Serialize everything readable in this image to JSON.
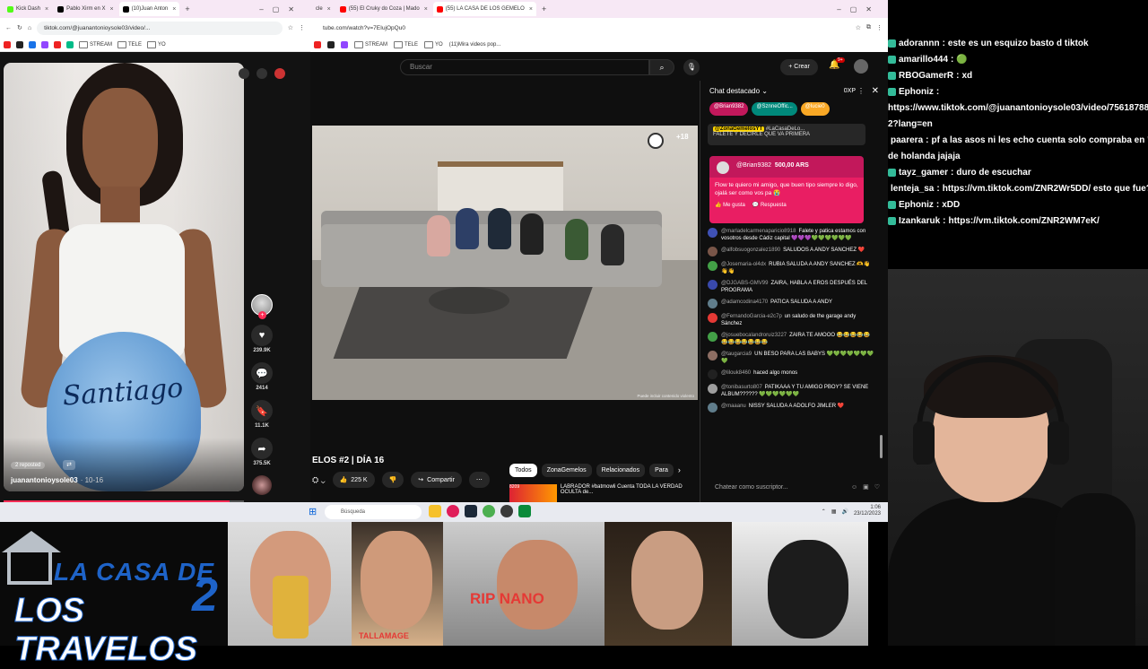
{
  "left_browser": {
    "tabs": [
      {
        "label": "Kick Dash",
        "color": "#53fc18",
        "active": false
      },
      {
        "label": "Pablo Xirm en X",
        "color": "#000000",
        "active": false
      },
      {
        "label": "(10)Juan Anton",
        "color": "#000000",
        "active": true
      }
    ],
    "url": "tiktok.com/@juanantonioysole03/video/...",
    "bookmarks": [
      "STREAM",
      "TELE",
      "YO"
    ]
  },
  "tiktok": {
    "belly_text": "Santiago",
    "reposted": "2 reposted",
    "username": "juanantonioysole03",
    "date": "· 10-16",
    "likes": "239.9K",
    "comments": "2414",
    "saves": "11.1K",
    "shares": "375.5K",
    "progress": 0.94
  },
  "mid_browser": {
    "tabs": [
      {
        "label": "cle",
        "color": "#ff0000",
        "active": false
      },
      {
        "label": "(55) El Cruky do Coza | Mado",
        "color": "#ff0000",
        "active": false
      },
      {
        "label": "(55) LA CASA DE LOS GEMELO",
        "color": "#ff0000",
        "active": true
      }
    ],
    "url": "tube.com/watch?v=7EIujOpQu0",
    "bookmarks": [
      "STREAM",
      "TELE",
      "YO",
      "(11)Mira videos pop..."
    ]
  },
  "youtube": {
    "search_placeholder": "Buscar",
    "create_label": "Crear",
    "notif_count": "9+",
    "age_badge": "+18",
    "disclaimer": "Puede incluir contenido violento",
    "title": "ELOS #2 | DÍA 16",
    "likes": "225 K",
    "share_label": "Compartir",
    "chips": [
      "Todos",
      "ZonaGemelos",
      "Relacionados",
      "Para"
    ],
    "rec_title": "LABRADOR #batmowli Cuenta TODA LA VERDAD OCULTA de...",
    "rec_badge": "8209"
  },
  "chat": {
    "header": "Chat destacado",
    "xp": "0XP",
    "tickers": [
      {
        "label": "@Brian9382",
        "color": "#c2185b"
      },
      {
        "label": "@SznneOffic...",
        "color": "#00897b"
      },
      {
        "label": "@lucie0",
        "color": "#f9a825"
      }
    ],
    "pinned_author": "@ZonaGemelosYT",
    "pinned_tag": "#LaCasaDeLo...",
    "pinned_text": "FALETE Y DECIRLE QUE VA PRIMERA",
    "superchat": {
      "author": "@Brian9382",
      "amount": "500,00 ARS",
      "text": "Flow te quiero mi amigo, que buen tipo siempre lo digo, ojalá ser como vos pa 😭",
      "like": "Me gusta",
      "reply": "Respuesta"
    },
    "messages": [
      {
        "author": "@marladelcarmenaparicio8918",
        "text": "Falete y patica estamos con vosotros desde Cádiz capital 💜💜💜💚💚💚💚💚💚",
        "color": "#3f51b5"
      },
      {
        "author": "@alfobsuogonzalez1890",
        "text": "SALUDOS A ANDY SANCHEZ ❤️",
        "color": "#795548"
      },
      {
        "author": "@Josemaria-ol4dx",
        "text": "RUBIA SALUDA A ANDY SANCHEZ 🫶👋👋👋",
        "color": "#43a047"
      },
      {
        "author": "@DJGABS-GMV99",
        "text": "ZAIRA, HABLA A EROS DESPUÉS DEL PROGRAMA",
        "color": "#3949ab"
      },
      {
        "author": "@adamcodina4170",
        "text": "PATICA SALUDA A ANDY",
        "color": "#607d8b"
      },
      {
        "author": "@FernandoGarcia-e2c7p",
        "text": "un saludo de the garage andy Sánchez",
        "color": "#e53935"
      },
      {
        "author": "@josuebocalandroruiz3227",
        "text": "ZAIRA TE AMOOO 😂😂😂😂😂😂😂😂😂😂😂😂",
        "color": "#43a047"
      },
      {
        "author": "@taugarcia9",
        "text": "UN BESO PARA LAS BABYS 💚💚💚💚💚💚💚💚",
        "color": "#8d6e63"
      },
      {
        "author": "@lilouk8460",
        "text": "haced algo monos",
        "color": "#212121"
      },
      {
        "author": "@tonibasurto807",
        "text": "PATIKAAA Y TU AMIGO PBOY? SE VIENE ALBUM?????? 💚💚💚💚💚💚",
        "color": "#9e9e9e"
      },
      {
        "author": "@maaanu",
        "text": "NISSY SALUDA A ADOLFO JIMLER ❤️",
        "color": "#607d8b"
      }
    ],
    "input_placeholder": "Chatear como suscriptor..."
  },
  "taskbar": {
    "search": "Búsqueda",
    "time": "1:06",
    "date": "23/12/2023"
  },
  "twitch_chat": [
    {
      "user": "adorannn",
      "text": "este es un esquizo basto d tiktok"
    },
    {
      "user": "amarillo444",
      "text": "🟢"
    },
    {
      "user": "RBOGamerR",
      "text": "xd"
    },
    {
      "user": "Ephoniz",
      "text": ""
    },
    {
      "user": "",
      "text": "https://www.tiktok.com/@juanantonioysole03/video/75618788"
    },
    {
      "user": "",
      "text": "2?lang=en"
    },
    {
      "user": "paarera",
      "text": "pf a las asos ni les echo cuenta solo compraba en \"asc"
    },
    {
      "user": "",
      "text": "de holanda jajaja"
    },
    {
      "user": "tayz_gamer",
      "text": "duro de escuchar"
    },
    {
      "user": "lenteja_sa",
      "text": "https://vm.tiktok.com/ZNR2Wr5DD/ esto que fue?"
    },
    {
      "user": "Ephoniz",
      "text": "xDD"
    },
    {
      "user": "Izankaruk",
      "text": "https://vm.tiktok.com/ZNR2WM7eK/"
    }
  ],
  "bottom_strip": {
    "logo_line1": "LA CASA DE",
    "logo_line2": "LOS TRAVELOS",
    "logo_number": "2",
    "caption1": "TALLAMAGE",
    "caption2": "RIP NANO"
  }
}
